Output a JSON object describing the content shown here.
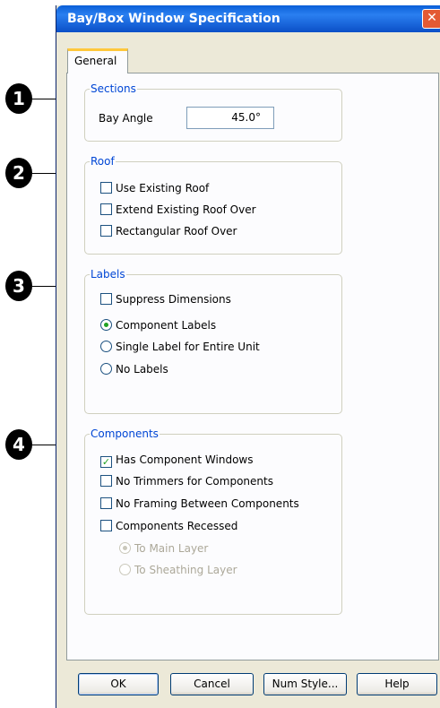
{
  "window": {
    "title": "Bay/Box Window Specification",
    "close_glyph": "✕"
  },
  "tabs": [
    {
      "label": "General",
      "selected": true
    }
  ],
  "callouts": [
    "1",
    "2",
    "3",
    "4"
  ],
  "sections": {
    "legend": "Sections",
    "bay_angle": {
      "label": "Bay Angle",
      "value": "45.0°"
    }
  },
  "roof": {
    "legend": "Roof",
    "options": [
      {
        "label": "Use Existing Roof",
        "checked": false
      },
      {
        "label": "Extend Existing Roof Over",
        "checked": false
      },
      {
        "label": "Rectangular Roof Over",
        "checked": false
      }
    ]
  },
  "labels": {
    "legend": "Labels",
    "suppress_dimensions": {
      "label": "Suppress Dimensions",
      "checked": false
    },
    "radios": [
      {
        "label": "Component Labels",
        "selected": true
      },
      {
        "label": "Single Label for Entire Unit",
        "selected": false
      },
      {
        "label": "No Labels",
        "selected": false
      }
    ]
  },
  "components": {
    "legend": "Components",
    "options": [
      {
        "label": "Has Component Windows",
        "checked": true
      },
      {
        "label": "No Trimmers for Components",
        "checked": false
      },
      {
        "label": "No Framing Between Components",
        "checked": false
      },
      {
        "label": "Components Recessed",
        "checked": false
      }
    ],
    "recess_radios": [
      {
        "label": "To Main Layer",
        "selected": true,
        "enabled": false
      },
      {
        "label": "To Sheathing Layer",
        "selected": false,
        "enabled": false
      }
    ]
  },
  "buttons": {
    "ok": "OK",
    "cancel": "Cancel",
    "num_style": "Num Style...",
    "help": "Help"
  },
  "colors": {
    "titlebar": "#0a5fd8",
    "legend_text": "#0046d5",
    "check_mark": "#21a121",
    "tab_highlight": "#ffc83c"
  }
}
